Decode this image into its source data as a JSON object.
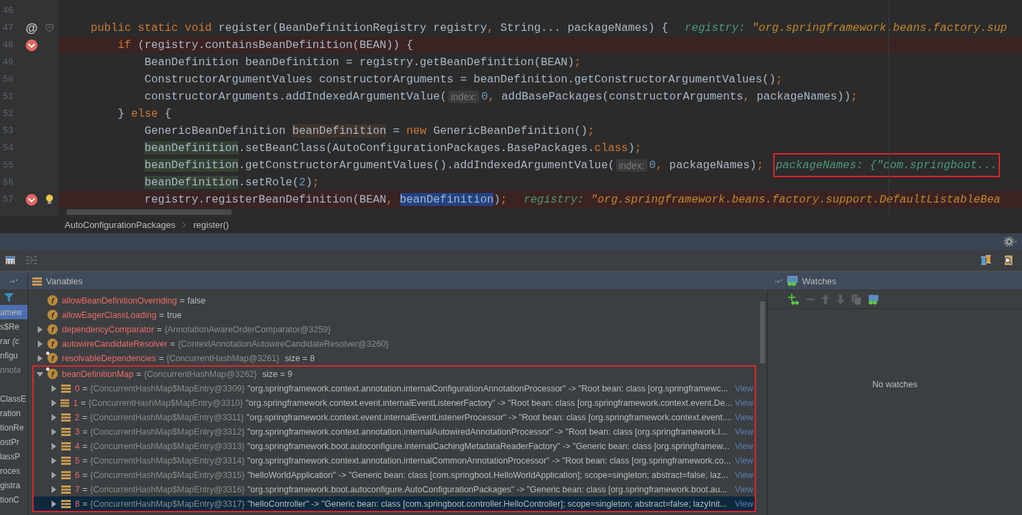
{
  "editor": {
    "lines": [
      {
        "number": "46",
        "breakpoint": false
      },
      {
        "number": "47",
        "breakpoint": false,
        "marker": "@",
        "foldable": true,
        "segments": [
          {
            "kind": "keyword",
            "text": "public static void "
          },
          {
            "kind": "plain",
            "text": "register(BeanDefinitionRegistry registry"
          },
          {
            "kind": "keyword",
            "text": ", "
          },
          {
            "kind": "plain",
            "text": "String... packageNames) {"
          },
          {
            "kind": "debug-string",
            "name": "registry:",
            "value": "\"org.springframework.beans.factory.sup",
            "annotated": false
          }
        ],
        "children": [
          {
            "number": "48",
            "breakpoint": true,
            "segments": [
              {
                "kind": "keyword",
                "text": "if "
              },
              {
                "kind": "plain",
                "text": "(registry.containsBeanDefinition(BEAN)) {"
              }
            ],
            "children": [
              {
                "number": "49",
                "breakpoint": false,
                "segments": [
                  {
                    "kind": "plain",
                    "text": "BeanDefinition beanDefinition = registry.getBeanDefinition(BEAN)"
                  },
                  {
                    "kind": "keyword",
                    "text": ";"
                  }
                ]
              },
              {
                "number": "50",
                "breakpoint": false,
                "segments": [
                  {
                    "kind": "plain",
                    "text": "ConstructorArgumentValues constructorArguments = beanDefinition.getConstructorArgumentValues()"
                  },
                  {
                    "kind": "keyword",
                    "text": ";"
                  }
                ]
              },
              {
                "number": "51",
                "breakpoint": false,
                "segments": [
                  {
                    "kind": "plain",
                    "text": "constructorArguments.addIndexedArgumentValue("
                  },
                  {
                    "kind": "hint",
                    "text": "index:"
                  },
                  {
                    "kind": "number",
                    "text": "0"
                  },
                  {
                    "kind": "keyword",
                    "text": ", "
                  },
                  {
                    "kind": "plain",
                    "text": "addBasePackages(constructorArguments"
                  },
                  {
                    "kind": "keyword",
                    "text": ", "
                  },
                  {
                    "kind": "plain",
                    "text": "packageNames))"
                  },
                  {
                    "kind": "keyword",
                    "text": ";"
                  }
                ]
              }
            ]
          },
          {
            "number": "52",
            "breakpoint": false,
            "segments": [
              {
                "kind": "plain",
                "text": "} "
              },
              {
                "kind": "keyword",
                "text": "else "
              },
              {
                "kind": "plain",
                "text": "{"
              }
            ],
            "children": [
              {
                "number": "53",
                "breakpoint": false,
                "segments": [
                  {
                    "kind": "plain",
                    "text": "GenericBeanDefinition "
                  },
                  {
                    "kind": "local-write",
                    "text": "beanDefinition"
                  },
                  {
                    "kind": "plain",
                    "text": " = "
                  },
                  {
                    "kind": "keyword",
                    "text": "new "
                  },
                  {
                    "kind": "plain",
                    "text": "GenericBeanDefinition()"
                  },
                  {
                    "kind": "keyword",
                    "text": ";"
                  }
                ]
              },
              {
                "number": "54",
                "breakpoint": false,
                "segments": [
                  {
                    "kind": "local-read",
                    "text": "beanDefinition"
                  },
                  {
                    "kind": "plain",
                    "text": ".setBeanClass(AutoConfigurationPackages.BasePackages."
                  },
                  {
                    "kind": "keyword",
                    "text": "class"
                  },
                  {
                    "kind": "plain",
                    "text": ")"
                  },
                  {
                    "kind": "keyword",
                    "text": ";"
                  }
                ]
              },
              {
                "number": "55",
                "breakpoint": false,
                "segments": [
                  {
                    "kind": "local-read",
                    "text": "beanDefinition"
                  },
                  {
                    "kind": "plain",
                    "text": ".getConstructorArgumentValues().addIndexedArgumentValue("
                  },
                  {
                    "kind": "hint",
                    "text": "index:"
                  },
                  {
                    "kind": "number",
                    "text": "0"
                  },
                  {
                    "kind": "keyword",
                    "text": ", "
                  },
                  {
                    "kind": "plain",
                    "text": "packageNames)"
                  },
                  {
                    "kind": "keyword",
                    "text": ";"
                  },
                  {
                    "kind": "debug-object",
                    "name": "packageNames:",
                    "value": "{\"com.springboot...",
                    "annotated": true
                  }
                ]
              },
              {
                "number": "56",
                "breakpoint": false,
                "segments": [
                  {
                    "kind": "local-read",
                    "text": "beanDefinition"
                  },
                  {
                    "kind": "plain",
                    "text": ".setRole("
                  },
                  {
                    "kind": "number",
                    "text": "2"
                  },
                  {
                    "kind": "plain",
                    "text": ")"
                  },
                  {
                    "kind": "keyword",
                    "text": ";"
                  }
                ]
              },
              {
                "number": "57",
                "breakpoint": true,
                "intention": true,
                "segments": [
                  {
                    "kind": "plain",
                    "text": "registry.registerBeanDefinition(BEAN"
                  },
                  {
                    "kind": "keyword",
                    "text": ", "
                  },
                  {
                    "kind": "selected",
                    "text": "beanDefinition"
                  },
                  {
                    "kind": "plain",
                    "text": ")"
                  },
                  {
                    "kind": "keyword",
                    "text": ";"
                  },
                  {
                    "kind": "debug-string",
                    "name": "registry:",
                    "value": "\"org.springframework.beans.factory.support.DefaultListableBea",
                    "annotated": false
                  }
                ]
              }
            ]
          }
        ]
      }
    ]
  },
  "breadcrumbs": [
    "AutoConfigurationPackages",
    "register()"
  ],
  "frames": [
    {
      "text": "amew",
      "selected": true,
      "dimmed": false
    },
    {
      "text": "s$Re",
      "selected": false,
      "dimmed": false
    },
    {
      "text": "rar *(c*",
      "selected": false,
      "dimmed": false
    },
    {
      "text": "nfigu",
      "selected": false,
      "dimmed": false
    },
    {
      "text": "nnota",
      "selected": false,
      "dimmed": true
    },
    {
      "selected": false
    },
    {
      "text": "ClassE",
      "selected": false,
      "dimmed": false
    },
    {
      "text": "ration",
      "selected": false,
      "dimmed": false
    },
    {
      "text": "tionRe",
      "selected": false,
      "dimmed": false
    },
    {
      "text": "ostPr",
      "selected": false,
      "dimmed": false
    },
    {
      "text": "lassP",
      "selected": false,
      "dimmed": false
    },
    {
      "text": "roces",
      "selected": false,
      "dimmed": false
    },
    {
      "text": "gistra",
      "selected": false,
      "dimmed": false
    },
    {
      "text": "tionC",
      "selected": false,
      "dimmed": false
    }
  ],
  "variables": {
    "title": "Variables",
    "items": [
      {
        "badge": "f",
        "name": "allowBeanDefinitionOverriding",
        "separator": "=",
        "value": "false",
        "expandable": false,
        "pinned": false,
        "annotated": false
      },
      {
        "badge": "f",
        "name": "allowEagerClassLoading",
        "separator": "=",
        "value": "true",
        "expandable": false,
        "pinned": false,
        "annotated": false
      },
      {
        "badge": "f",
        "name": "dependencyComparator",
        "separator": "=",
        "ref": "{AnnotationAwareOrderComparator@3259}",
        "expandable": true,
        "expanded": false,
        "pinned": false,
        "annotated": false
      },
      {
        "badge": "f",
        "name": "autowireCandidateResolver",
        "separator": "=",
        "ref": "{ContextAnnotationAutowireCandidateResolver@3260}",
        "expandable": true,
        "expanded": false,
        "pinned": false,
        "annotated": false
      },
      {
        "badge": "f",
        "name": "resolvableDependencies",
        "separator": "=",
        "ref": "{ConcurrentHashMap@3261}",
        "size": "size = 8",
        "expandable": true,
        "expanded": false,
        "pinned": true,
        "annotated": false
      },
      {
        "badge": "f",
        "name": "beanDefinitionMap",
        "separator": "=",
        "ref": "{ConcurrentHashMap@3262}",
        "size": "size = 9",
        "expandable": true,
        "expanded": true,
        "pinned": true,
        "annotated": true,
        "children": [
          {
            "index": "0",
            "separator": "=",
            "ref": "{ConcurrentHashMap$MapEntry@3309}",
            "value": "\"org.springframework.context.annotation.internalConfigurationAnnotationProcessor\" -> \"Root bean: class [org.springframewc...",
            "link": "View",
            "selected": false
          },
          {
            "index": "1",
            "separator": "=",
            "ref": "{ConcurrentHashMap$MapEntry@3310}",
            "value": "\"org.springframework.context.event.internalEventListenerFactory\" -> \"Root bean: class [org.springframework.context.event.De...",
            "link": "View",
            "selected": false
          },
          {
            "index": "2",
            "separator": "=",
            "ref": "{ConcurrentHashMap$MapEntry@3311}",
            "value": "\"org.springframework.context.event.internalEventListenerProcessor\" -> \"Root bean: class [org.springframework.context.event....",
            "link": "View",
            "selected": false
          },
          {
            "index": "3",
            "separator": "=",
            "ref": "{ConcurrentHashMap$MapEntry@3312}",
            "value": "\"org.springframework.context.annotation.internalAutowiredAnnotationProcessor\" -> \"Root bean: class [org.springframework.l...",
            "link": "View",
            "selected": false
          },
          {
            "index": "4",
            "separator": "=",
            "ref": "{ConcurrentHashMap$MapEntry@3313}",
            "value": "\"org.springframework.boot.autoconfigure.internalCachingMetadataReaderFactory\" -> \"Generic bean: class [org.springframew...",
            "link": "View",
            "selected": false
          },
          {
            "index": "5",
            "separator": "=",
            "ref": "{ConcurrentHashMap$MapEntry@3314}",
            "value": "\"org.springframework.context.annotation.internalCommonAnnotationProcessor\" -> \"Root bean: class [org.springframework.co...",
            "link": "View",
            "selected": false
          },
          {
            "index": "6",
            "separator": "=",
            "ref": "{ConcurrentHashMap$MapEntry@3315}",
            "value": "\"helloWorldApplication\" -> \"Generic bean: class [com.springboot.HelloWorldApplication]; scope=singleton; abstract=false; laz...",
            "link": "View",
            "selected": false
          },
          {
            "index": "7",
            "separator": "=",
            "ref": "{ConcurrentHashMap$MapEntry@3316}",
            "value": "\"org.springframework.boot.autoconfigure.AutoConfigurationPackages\" -> \"Generic bean: class [org.springframework.boot.au...",
            "link": "View",
            "selected": false
          },
          {
            "index": "8",
            "separator": "=",
            "ref": "{ConcurrentHashMap$MapEntry@3317}",
            "value": "\"helloController\" -> \"Generic bean: class [com.springboot.controller.HelloController]; scope=singleton; abstract=false; lazyInit...",
            "link": "View",
            "selected": true
          }
        ]
      }
    ]
  },
  "watches": {
    "title": "Watches",
    "tools": [
      {
        "kind": "add",
        "disabled": false
      },
      {
        "kind": "remove",
        "disabled": true
      },
      {
        "kind": "up",
        "disabled": true
      },
      {
        "kind": "down",
        "disabled": true
      },
      {
        "kind": "copy",
        "disabled": true
      },
      {
        "kind": "watch",
        "disabled": false
      }
    ],
    "empty_text": "No watches"
  }
}
